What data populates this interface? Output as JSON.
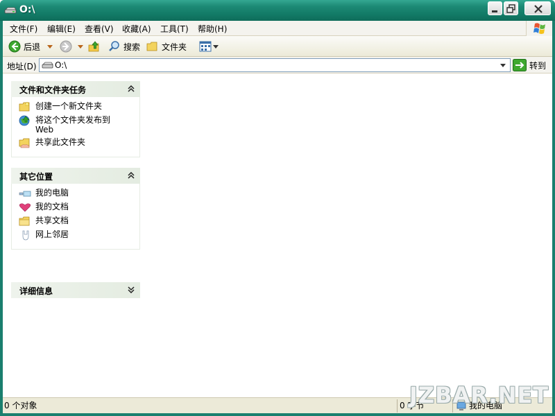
{
  "window": {
    "title": "O:\\",
    "titlebar_color": "#1d8a75"
  },
  "menu": {
    "items": [
      {
        "label": "文件(F)"
      },
      {
        "label": "编辑(E)"
      },
      {
        "label": "查看(V)"
      },
      {
        "label": "收藏(A)"
      },
      {
        "label": "工具(T)"
      },
      {
        "label": "帮助(H)"
      }
    ]
  },
  "toolbar": {
    "back_label": "后退",
    "search_label": "搜索",
    "folders_label": "文件夹"
  },
  "address": {
    "label": "地址(D)",
    "value": "O:\\",
    "go_label": "转到"
  },
  "panels": {
    "tasks": {
      "title": "文件和文件夹任务",
      "items": [
        {
          "label": "创建一个新文件夹",
          "icon": "new-folder-icon"
        },
        {
          "label": "将这个文件夹发布到",
          "label2": "Web",
          "icon": "publish-web-icon"
        },
        {
          "label": "共享此文件夹",
          "icon": "share-folder-icon"
        }
      ]
    },
    "places": {
      "title": "其它位置",
      "items": [
        {
          "label": "我的电脑",
          "icon": "my-computer-icon"
        },
        {
          "label": "我的文档",
          "icon": "my-documents-icon"
        },
        {
          "label": "共享文档",
          "icon": "shared-documents-icon"
        },
        {
          "label": "网上邻居",
          "icon": "network-places-icon"
        }
      ]
    },
    "details": {
      "title": "详细信息"
    }
  },
  "status": {
    "objects": "0 个对象",
    "size": "0 字节",
    "location": "我的电脑"
  },
  "watermark": "JZBAR.NET"
}
